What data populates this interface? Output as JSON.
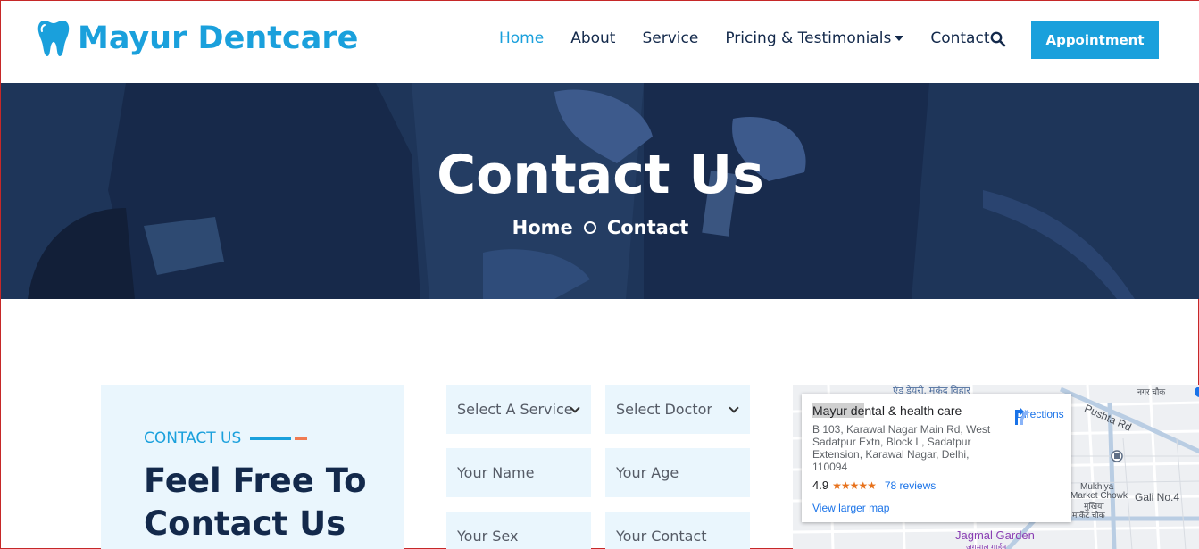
{
  "brand": {
    "name": "Mayur Dentcare",
    "accent": "#1aa0dc",
    "navy": "#13294b"
  },
  "nav": {
    "items": [
      {
        "label": "Home",
        "active": true
      },
      {
        "label": "About",
        "active": false
      },
      {
        "label": "Service",
        "active": false
      },
      {
        "label": "Pricing & Testimonials",
        "active": false,
        "dropdown": true
      },
      {
        "label": "Contact",
        "active": false
      }
    ],
    "appointment_label": "Appointment"
  },
  "hero": {
    "title": "Contact Us",
    "breadcrumb": [
      "Home",
      "Contact"
    ]
  },
  "contact_card": {
    "kicker": "CONTACT US",
    "heading": "Feel Free To Contact Us"
  },
  "form": {
    "service_select": "Select A Service",
    "doctor_select": "Select Doctor",
    "name_placeholder": "Your Name",
    "age_placeholder": "Your Age",
    "sex_placeholder": "Your Sex",
    "contact_placeholder": "Your Contact"
  },
  "map": {
    "place_name_hl": "Mayur de",
    "place_name_rest": "ntal & health care",
    "address": "B 103, Karawal Nagar Main Rd, West Sadatpur Extn, Block L, Sadatpur Extension, Karawal Nagar, Delhi, 110094",
    "rating": "4.9",
    "stars": "★★★★★",
    "reviews": "78 reviews",
    "directions": "Directions",
    "view_larger": "View larger map",
    "labels": {
      "top_hindi": "एंड डेयरी, मुकुंद विहार",
      "nagar_chowk": "नगर चौक",
      "pushta": "Pushta Rd",
      "mukhiya1": "Mukhiya",
      "mukhiya2": "Market Chowk",
      "mukhiya3": "मुखिया",
      "mukhiya4": "मार्केट चौक",
      "gali": "Gali No.4",
      "jagmal": "Jagmal Garden",
      "jagmal_hi": "जगमाल गार्डन"
    }
  }
}
